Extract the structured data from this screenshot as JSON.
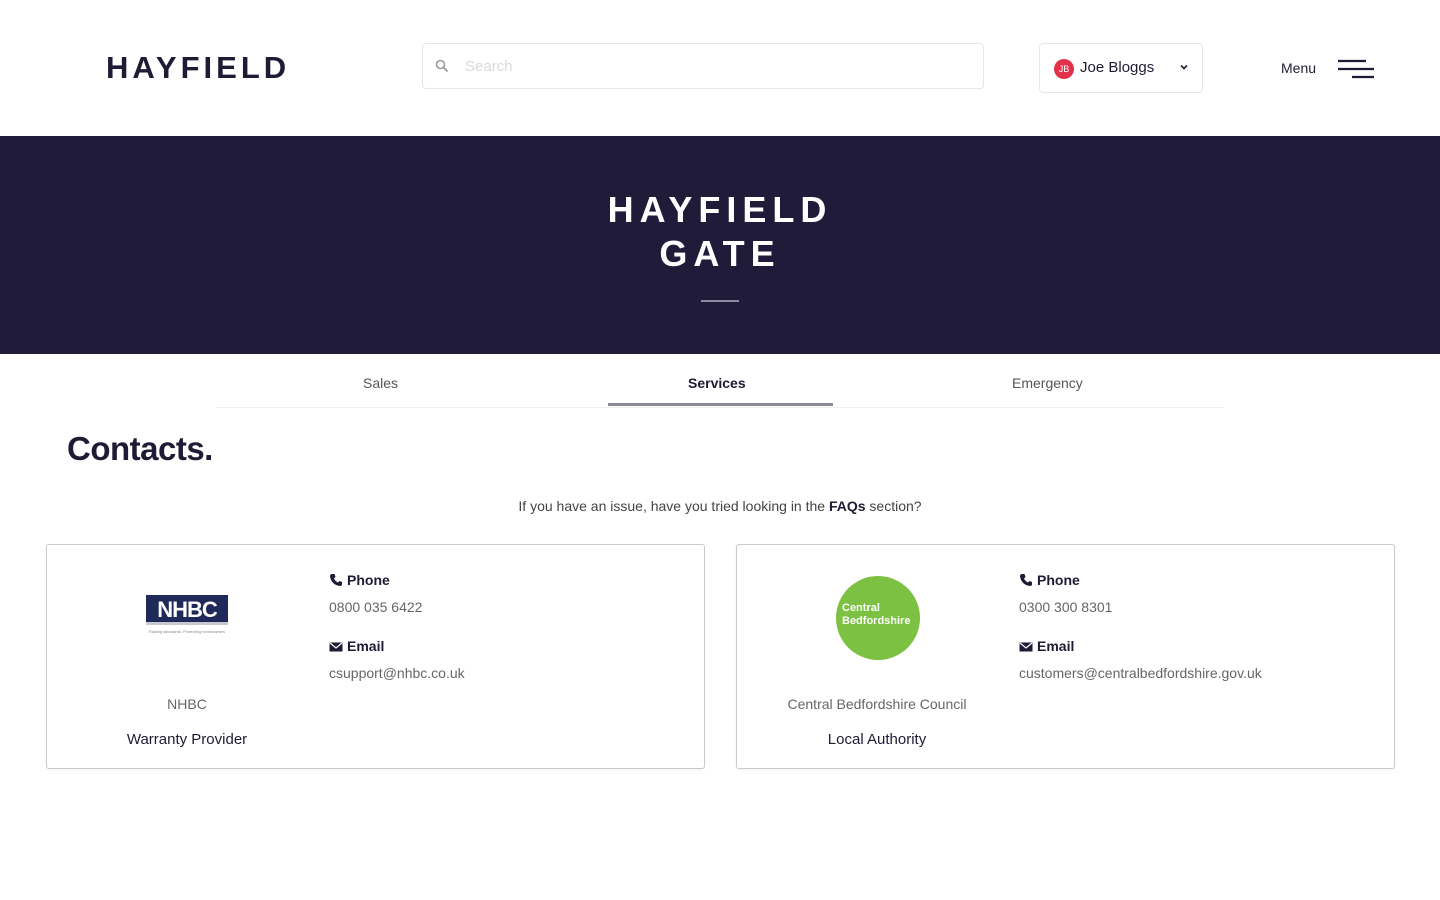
{
  "header": {
    "logo": "HAYFIELD",
    "search_placeholder": "Search",
    "user": {
      "initials": "JB",
      "name": "Joe Bloggs"
    },
    "menu_label": "Menu"
  },
  "hero": {
    "title_line1": "HAYFIELD",
    "title_line2": "GATE"
  },
  "tabs": [
    {
      "label": "Sales",
      "active": false
    },
    {
      "label": "Services",
      "active": true
    },
    {
      "label": "Emergency",
      "active": false
    }
  ],
  "contacts": {
    "title": "Contacts.",
    "faq_prefix": "If you have an issue, have you tried looking in the ",
    "faq_link": "FAQs",
    "faq_suffix": " section?",
    "cards": [
      {
        "logo_text": "NHBC",
        "logo_tagline": "Raising standards. Protecting homeowners",
        "org_name": "NHBC",
        "role": "Warranty Provider",
        "phone_label": "Phone",
        "phone": "0800 035 6422",
        "email_label": "Email",
        "email": "csupport@nhbc.co.uk"
      },
      {
        "logo_text_line1": "Central",
        "logo_text_line2": "Bedfordshire",
        "org_name": "Central Bedfordshire Council",
        "role": "Local Authority",
        "phone_label": "Phone",
        "phone": "0300 300 8301",
        "email_label": "Email",
        "email": "customers@centralbedfordshire.gov.uk"
      }
    ]
  },
  "colors": {
    "brand_navy": "#1f1b38",
    "avatar_red": "#e2324b",
    "council_green": "#7cc142"
  }
}
